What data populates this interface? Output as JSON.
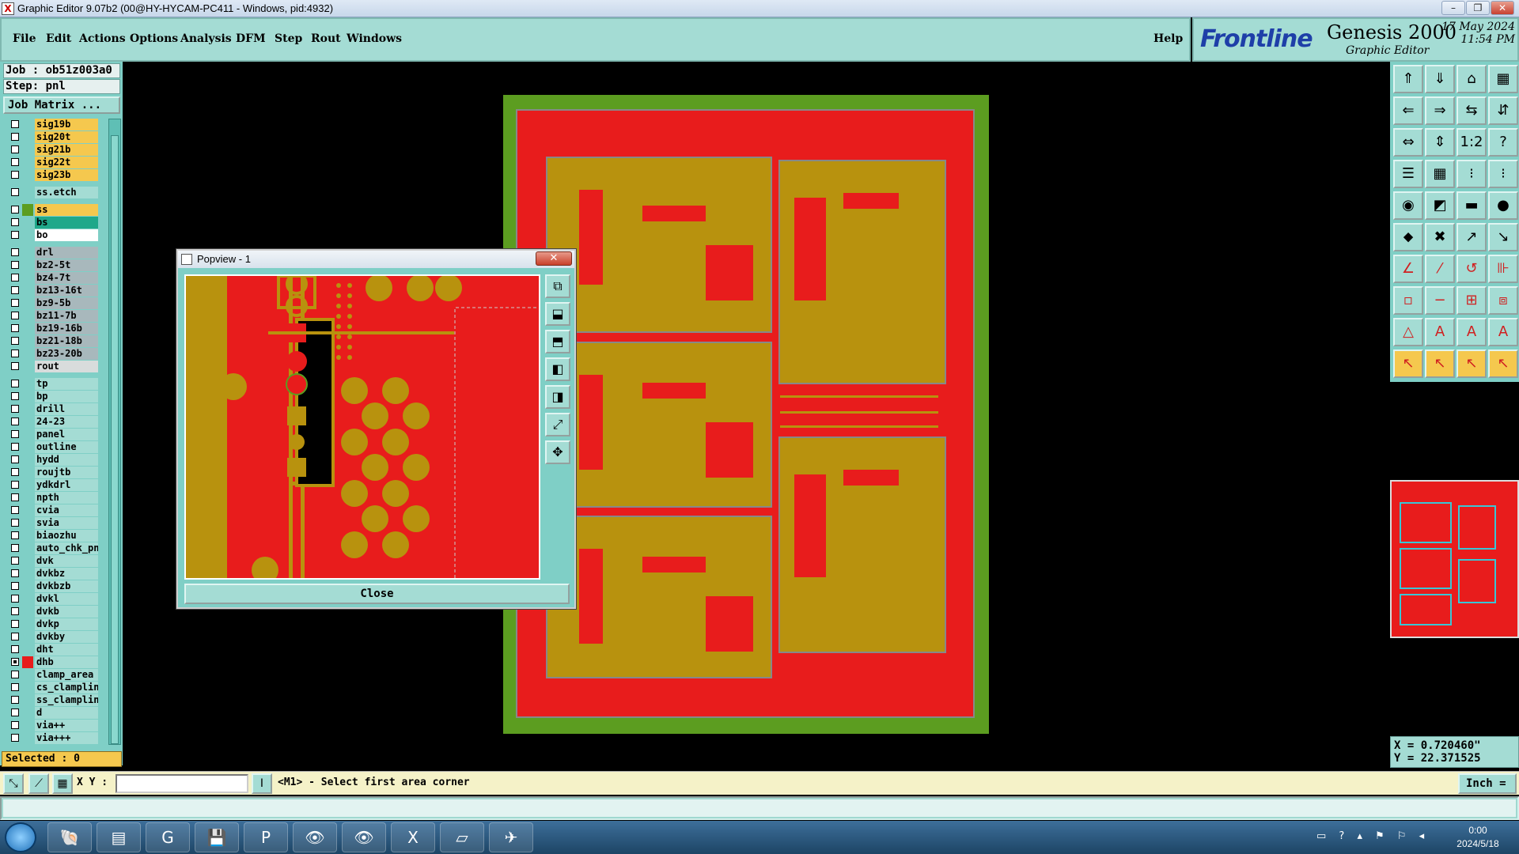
{
  "window": {
    "title": "Graphic Editor 9.07b2 (00@HY-HYCAM-PC411 - Windows, pid:4932)",
    "app_icon": "x-icon",
    "minimize": "–",
    "restore": "❐",
    "close": "✕"
  },
  "menu": {
    "items": [
      "File",
      "Edit",
      "Actions",
      "Options",
      "Analysis",
      "DFM",
      "Step",
      "Rout",
      "Windows"
    ],
    "help": "Help"
  },
  "brand": {
    "logo": "Frontline",
    "product": "Genesis 2000",
    "subtitle": "Graphic Editor",
    "date": "17 May 2024",
    "time": "11:54 PM"
  },
  "job": {
    "job_label": "Job  : ob51z003a0",
    "step_label": "Step: pnl",
    "job_matrix": "Job Matrix ..."
  },
  "layers": [
    {
      "name": "sig19b",
      "color": "#f5c84e",
      "checked": false
    },
    {
      "name": "sig20t",
      "color": "#f5c84e",
      "checked": false
    },
    {
      "name": "sig21b",
      "color": "#f5c84e",
      "checked": false
    },
    {
      "name": "sig22t",
      "color": "#f5c84e",
      "checked": false
    },
    {
      "name": "sig23b",
      "color": "#f5c84e",
      "checked": false
    },
    {
      "name": "",
      "color": "",
      "checked": false,
      "gap": true
    },
    {
      "name": "ss.etch",
      "color": "#a4dcd4",
      "checked": false
    },
    {
      "name": "",
      "color": "",
      "checked": false,
      "gap": true
    },
    {
      "name": "ss",
      "color": "#f5c84e",
      "checked": false,
      "sw": "#5c9d20"
    },
    {
      "name": "bs",
      "color": "#1fa88a",
      "checked": false
    },
    {
      "name": "bo",
      "color": "#ffffff",
      "checked": false
    },
    {
      "name": "",
      "color": "",
      "checked": false,
      "gap": true
    },
    {
      "name": "drl",
      "color": "#a8b8bc",
      "checked": false
    },
    {
      "name": "bz2-5t",
      "color": "#a8b8bc",
      "checked": false
    },
    {
      "name": "bz4-7t",
      "color": "#a8b8bc",
      "checked": false
    },
    {
      "name": "bz13-16t",
      "color": "#a8b8bc",
      "checked": false
    },
    {
      "name": "bz9-5b",
      "color": "#a8b8bc",
      "checked": false
    },
    {
      "name": "bz11-7b",
      "color": "#a8b8bc",
      "checked": false
    },
    {
      "name": "bz19-16b",
      "color": "#a8b8bc",
      "checked": false
    },
    {
      "name": "bz21-18b",
      "color": "#a8b8bc",
      "checked": false
    },
    {
      "name": "bz23-20b",
      "color": "#a8b8bc",
      "checked": false
    },
    {
      "name": "rout",
      "color": "#d8dcdc",
      "checked": false
    },
    {
      "name": "",
      "color": "",
      "checked": false,
      "gap": true
    },
    {
      "name": "tp",
      "color": "#a4dcd4",
      "checked": false
    },
    {
      "name": "bp",
      "color": "#a4dcd4",
      "checked": false
    },
    {
      "name": "drill",
      "color": "#a4dcd4",
      "checked": false
    },
    {
      "name": "24-23",
      "color": "#a4dcd4",
      "checked": false
    },
    {
      "name": "panel",
      "color": "#a4dcd4",
      "checked": false
    },
    {
      "name": "outline",
      "color": "#a4dcd4",
      "checked": false
    },
    {
      "name": "hydd",
      "color": "#a4dcd4",
      "checked": false
    },
    {
      "name": "roujtb",
      "color": "#a4dcd4",
      "checked": false
    },
    {
      "name": "ydkdrl",
      "color": "#a4dcd4",
      "checked": false
    },
    {
      "name": "npth",
      "color": "#a4dcd4",
      "checked": false
    },
    {
      "name": "cvia",
      "color": "#a4dcd4",
      "checked": false
    },
    {
      "name": "svia",
      "color": "#a4dcd4",
      "checked": false
    },
    {
      "name": "biaozhu",
      "color": "#a4dcd4",
      "checked": false
    },
    {
      "name": "auto_chk_pnl",
      "color": "#a4dcd4",
      "checked": false
    },
    {
      "name": "dvk",
      "color": "#a4dcd4",
      "checked": false
    },
    {
      "name": "dvkbz",
      "color": "#a4dcd4",
      "checked": false
    },
    {
      "name": "dvkbzb",
      "color": "#a4dcd4",
      "checked": false
    },
    {
      "name": "dvkl",
      "color": "#a4dcd4",
      "checked": false
    },
    {
      "name": "dvkb",
      "color": "#a4dcd4",
      "checked": false
    },
    {
      "name": "dvkp",
      "color": "#a4dcd4",
      "checked": false
    },
    {
      "name": "dvkby",
      "color": "#a4dcd4",
      "checked": false
    },
    {
      "name": "dht",
      "color": "#a4dcd4",
      "checked": false
    },
    {
      "name": "dhb",
      "color": "#a4dcd4",
      "checked": true,
      "sw": "#e81c1c"
    },
    {
      "name": "clamp_area",
      "color": "#a4dcd4",
      "checked": false
    },
    {
      "name": "cs_clampline",
      "color": "#a4dcd4",
      "checked": false
    },
    {
      "name": "ss_clampline",
      "color": "#a4dcd4",
      "checked": false
    },
    {
      "name": "d",
      "color": "#a4dcd4",
      "checked": false
    },
    {
      "name": "via++",
      "color": "#a4dcd4",
      "checked": false
    },
    {
      "name": "via+++",
      "color": "#a4dcd4",
      "checked": false
    }
  ],
  "selected": "Selected : 0",
  "popview": {
    "title": "Popview - 1",
    "close_x": "✕",
    "close_button": "Close",
    "tools": [
      "⧉",
      "⬓",
      "⬒",
      "◧",
      "◨",
      "⤢",
      "✥"
    ]
  },
  "right_tools": [
    "⇑",
    "⇓",
    "⌂",
    "▦",
    "⇐",
    "⇒",
    "⇆",
    "⇵",
    "⇔",
    "⇕",
    "1:2",
    "?",
    "☰",
    "▦",
    "⁝",
    "⁝",
    "◉",
    "◩",
    "▬",
    "●",
    "⬥",
    "✖",
    "↗",
    "↘",
    "∠",
    "⁄",
    "↺",
    "⊪",
    "▫",
    "−",
    "⊞",
    "⧈",
    "△",
    "A",
    "A",
    "A",
    "↖",
    "↖",
    "↖",
    "↖"
  ],
  "coords": {
    "x": "X = 0.720460\"",
    "y": "Y = 22.371525"
  },
  "command": {
    "xy_label": "X Y :",
    "xy_value": "",
    "prompt": "<M1> - Select first area corner",
    "unit": "Inch ="
  },
  "taskbar": {
    "apps": [
      "🐚",
      "▤",
      "G",
      "💾",
      "P",
      "👁",
      "👁",
      "X",
      "▱",
      "✈"
    ],
    "tray": "▭ ? ▴ ⚑ ⚐ ◂",
    "time": "0:00",
    "date": "2024/5/18"
  },
  "colors": {
    "board_green": "#5c9d20",
    "copper_red": "#e81c1c",
    "gold": "#b8920e",
    "panel_cyan": "#7fcfc6"
  }
}
